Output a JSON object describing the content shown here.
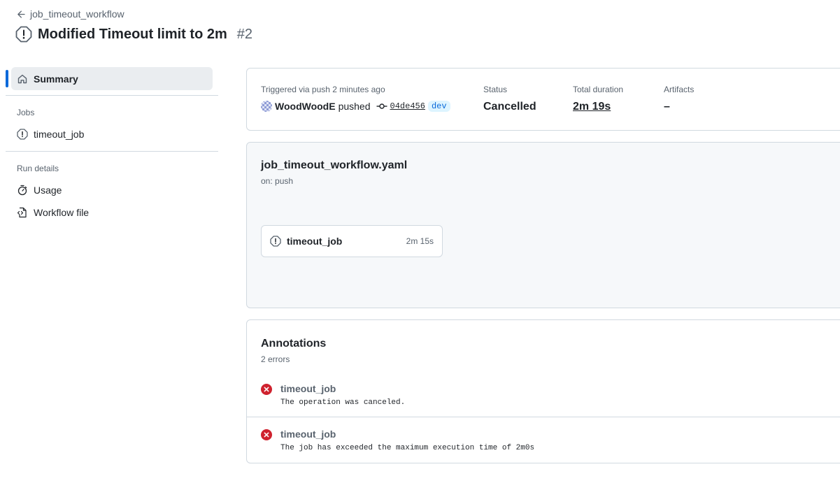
{
  "breadcrumb": {
    "back_label": "job_timeout_workflow"
  },
  "header": {
    "title": "Modified Timeout limit to 2m",
    "run_number": "#2"
  },
  "sidebar": {
    "summary_label": "Summary",
    "jobs_heading": "Jobs",
    "jobs": [
      {
        "label": "timeout_job"
      }
    ],
    "run_details_heading": "Run details",
    "run_details": [
      {
        "label": "Usage"
      },
      {
        "label": "Workflow file"
      }
    ]
  },
  "summary": {
    "trigger_label": "Triggered via push 2 minutes ago",
    "actor": "WoodWoodE",
    "action": "pushed",
    "commit": "04de456",
    "branch": "dev",
    "status_label": "Status",
    "status_value": "Cancelled",
    "duration_label": "Total duration",
    "duration_value": "2m 19s",
    "artifacts_label": "Artifacts",
    "artifacts_value": "–"
  },
  "graph": {
    "workflow_file": "job_timeout_workflow.yaml",
    "trigger": "on: push",
    "job": {
      "name": "timeout_job",
      "duration": "2m 15s"
    }
  },
  "annotations": {
    "title": "Annotations",
    "count": "2 errors",
    "items": [
      {
        "job": "timeout_job",
        "message": "The operation was canceled."
      },
      {
        "job": "timeout_job",
        "message": "The job has exceeded the maximum execution time of 2m0s"
      }
    ]
  },
  "colors": {
    "accent": "#0969da",
    "error": "#cf222e",
    "muted": "#59636e",
    "border": "#d1d9e0"
  },
  "icons": [
    "arrow-left-icon",
    "alert-circle-icon",
    "home-icon",
    "stopwatch-icon",
    "file-code-icon",
    "commit-icon",
    "x-circle-fill-icon"
  ]
}
